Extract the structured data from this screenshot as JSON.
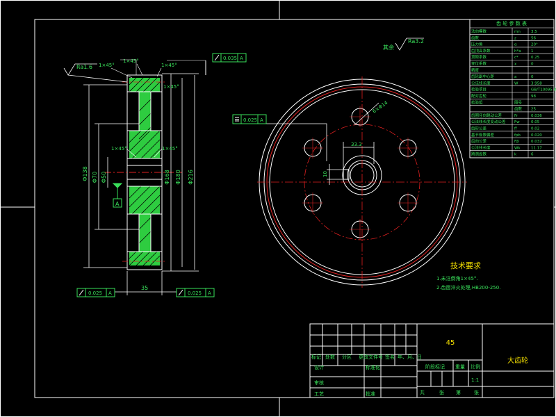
{
  "drawing": {
    "part_name": "大齿轮",
    "material": "45",
    "scale": "1:1",
    "finish_note": "其余",
    "finish_value": "Ra3.2"
  },
  "tech_requirements": {
    "title": "技术要求",
    "lines": [
      "1.未注倒角1×45°.",
      "2.齿面淬火处理,HB200-250."
    ]
  },
  "side_view": {
    "roughness_left": "Ra1.6",
    "chamfer_top_a": "1×45°",
    "chamfer_top_b": "1×45°",
    "chamfer_top_c": "1×45°",
    "chamfer_mid_left": "1×45°",
    "chamfer_mid_right": "1×45°",
    "runout_top": "0.035",
    "runout_top_datum": "A",
    "runout_bottom_left": "0.025",
    "runout_bottom_left_datum": "A",
    "runout_bottom_right": "0.025",
    "runout_bottom_right_datum": "A",
    "datum_label": "A",
    "width_dim": "35",
    "dim_v1": "Φ138",
    "dim_v2": "Φ70",
    "dim_v3": "Φ50",
    "dim_v4": "Φ168",
    "dim_v5": "Φ180",
    "dim_v6": "Φ216"
  },
  "front_view": {
    "hole_label": "6×Φ14",
    "keyway_dim": "33.3",
    "keyway_width": "10",
    "symmetry_tol": "0.025",
    "symmetry_datum": "A"
  },
  "gear_table": {
    "title": "齿 轮 参 数 表",
    "rows": [
      {
        "name": "法向模数",
        "sym": "mn",
        "val": "3.5"
      },
      {
        "name": "齿数",
        "sym": "z",
        "val": "56"
      },
      {
        "name": "压力角",
        "sym": "α",
        "val": "20°"
      },
      {
        "name": "齿顶高系数",
        "sym": "h*a",
        "val": "1"
      },
      {
        "name": "顶隙系数",
        "sym": "c*",
        "val": "0.25"
      },
      {
        "name": "变位系数",
        "sym": "x",
        "val": "0"
      },
      {
        "name": "精度",
        "sym": "",
        "val": ""
      },
      {
        "name": "齿轮副中心距",
        "sym": "a",
        "val": "0"
      },
      {
        "name": "公法线长度",
        "sym": "W",
        "val": "3.958"
      },
      {
        "name": "检验项目",
        "sym": "",
        "val": "GB/T10095-88"
      },
      {
        "name": "配对齿轮",
        "sym": "",
        "val": "98"
      },
      {
        "name": "检验组",
        "sym": "图号",
        "val": ""
      },
      {
        "name": "",
        "sym": "齿数",
        "val": "25"
      },
      {
        "name": "齿圈径向跳动公差",
        "sym": "Fr",
        "val": "0.036"
      },
      {
        "name": "公法线长度变动公差",
        "sym": "Fw",
        "val": "0.05"
      },
      {
        "name": "齿形公差",
        "sym": "ff",
        "val": "0.02"
      },
      {
        "name": "基节极限偏差",
        "sym": "fpb",
        "val": "0.020"
      },
      {
        "name": "齿向公差",
        "sym": "Fβ",
        "val": "0.032"
      },
      {
        "name": "公法线长度",
        "sym": "Wk",
        "val": "11.17"
      },
      {
        "name": "跨测齿数",
        "sym": "k",
        "val": "6"
      }
    ]
  },
  "title_block": {
    "col_labels": [
      "标记",
      "处数",
      "分区",
      "更改文件号",
      "签名",
      "年、月、日"
    ],
    "row_design": "设计",
    "row_standard": "标准化",
    "row_review": "审核",
    "row_process": "工艺",
    "row_approve": "批准",
    "stage_label": "阶段标记",
    "weight_label": "重量",
    "scale_label": "比例",
    "sheet_total": "共",
    "sheet_unit": "张",
    "sheet_num": "第",
    "sheet_unit2": "张"
  },
  "colors": {
    "line": "#39e05a",
    "white": "#ffffff",
    "red": "#e02020",
    "yellow": "#f5e000",
    "cyan": "#22d8e8",
    "fill_green": "#2ecc40"
  }
}
